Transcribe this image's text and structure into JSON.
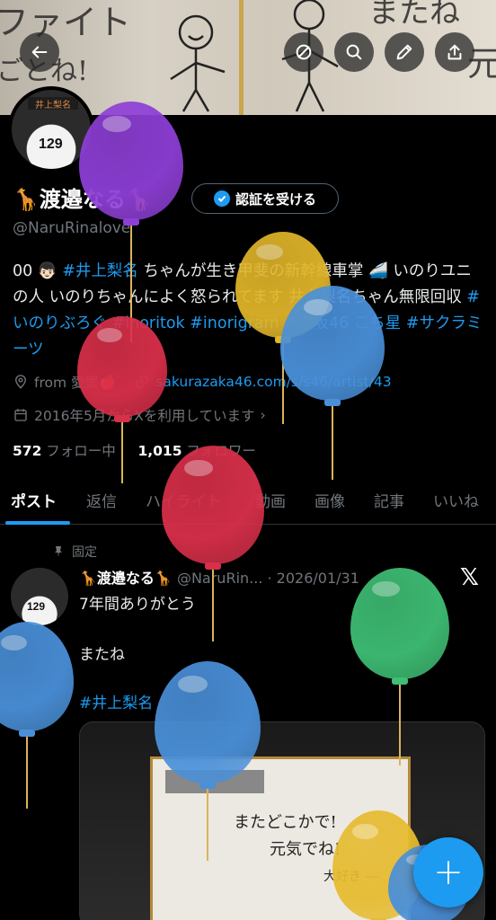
{
  "header": {
    "back_icon": "arrow-left-icon",
    "actions": [
      "circle-slash-icon",
      "search-icon",
      "pencil-icon",
      "share-icon"
    ],
    "banner_scribbles": [
      "ファイト",
      "ごとね!",
      "またね",
      "元"
    ]
  },
  "profile": {
    "avatar_jersey_number": "129",
    "avatar_sign": "井上梨名",
    "name": "🦒渡邉なる🦒",
    "verify_button": "認証を受ける",
    "handle": "@NaruRinalove",
    "bio_parts": [
      {
        "text": "00 👦🏻 ",
        "tag": false
      },
      {
        "text": "#井上梨名",
        "tag": true
      },
      {
        "text": " ちゃんが生き甲斐の新幹線車掌 🚄 いのりユニの人 いのりちゃんによく怒られてます 井上梨名ちゃん無限回収 ",
        "tag": false
      },
      {
        "text": "#いのりぶろぐ",
        "tag": true
      },
      {
        "text": " ",
        "tag": false
      },
      {
        "text": "#inoritok",
        "tag": true
      },
      {
        "text": " ",
        "tag": false
      },
      {
        "text": "#inorigram",
        "tag": true
      },
      {
        "text": " ",
        "tag": false
      },
      {
        "text": "#櫻坂46",
        "tag": true
      },
      {
        "text": " ",
        "tag": false
      },
      {
        "text": "こち星",
        "tag": true
      },
      {
        "text": " ",
        "tag": false
      },
      {
        "text": "#サクラミーツ",
        "tag": true
      }
    ],
    "location": "from 愛媛🍎",
    "website": "sakurazaka46.com/s/s46/artist/43",
    "joined": "2016年5月からXを利用しています",
    "following_count": "572",
    "following_label": "フォロー中",
    "followers_count": "1,015",
    "followers_label": "フォロワー"
  },
  "tabs": [
    "ポスト",
    "返信",
    "ハイライト",
    "動画",
    "画像",
    "記事",
    "いいね"
  ],
  "pinned_post": {
    "pinned_label": "固定",
    "author_name": "🦒渡邉なる🦒",
    "author_handle": "@NaruRin...",
    "date": "· 2026/01/31",
    "line1": "7年間ありがとう",
    "line2": "またね",
    "hashtag": "#井上梨名",
    "image_handwriting": [
      "またどこかで!",
      "元気でね!",
      "大好き ―"
    ]
  },
  "fab_label": "+",
  "colors": {
    "accent": "#1d9bf0",
    "background": "#000000",
    "muted": "#71767b",
    "balloon_colors": [
      "#8e3fd6",
      "#e0b52a",
      "#4a90d9",
      "#d9304a",
      "#3fbf75",
      "#e6bb2f"
    ]
  }
}
